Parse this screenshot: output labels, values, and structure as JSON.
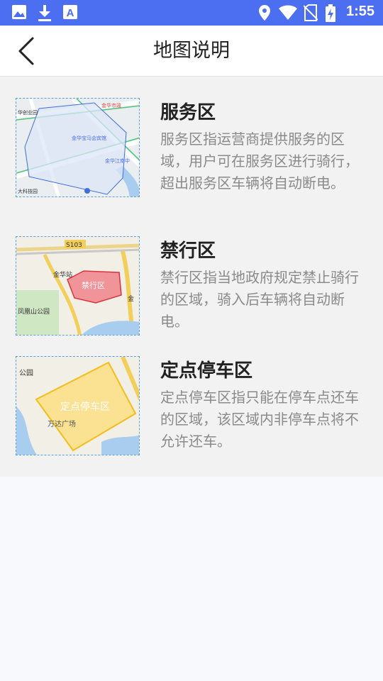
{
  "status_bar": {
    "time": "1:55",
    "left_icons": [
      "image-icon",
      "download-icon",
      "text-a-icon"
    ],
    "right_icons": [
      "location-icon",
      "wifi-icon",
      "no-sim-icon",
      "battery-charging-icon"
    ]
  },
  "header": {
    "title": "地图说明",
    "back_icon": "chevron-left-icon"
  },
  "zones": [
    {
      "title": "服务区",
      "description": "服务区指运营商提供服务的区域，用户可在服务区进行骑行，超出服务区车辆将自动断电。",
      "map_labels": [
        "金华宝马会宾馆",
        "金华江南中",
        "大科技园",
        "华创业园"
      ]
    },
    {
      "title": "禁行区",
      "description": "禁行区指当地政府规定禁止骑行的区域，骑入后车辆将自动断电。",
      "map_labels": [
        "S103",
        "金华站",
        "禁行区",
        "凤凰山公园",
        "金"
      ]
    },
    {
      "title": "定点停车区",
      "description": "定点停车区指只能在停车点还车的区域，该区域内非停车点将不允许还车。",
      "map_labels": [
        "定点停车区",
        "万达广场",
        "公园"
      ]
    }
  ],
  "colors": {
    "status_bar": "#4c6ef0",
    "service_zone_fill": "#dce6f8",
    "service_zone_border": "#3f6fd8",
    "restricted_zone_fill": "#f08a90",
    "restricted_zone_border": "#d8343e",
    "parking_zone_fill": "#fce08a",
    "parking_zone_border": "#f2be1c"
  }
}
